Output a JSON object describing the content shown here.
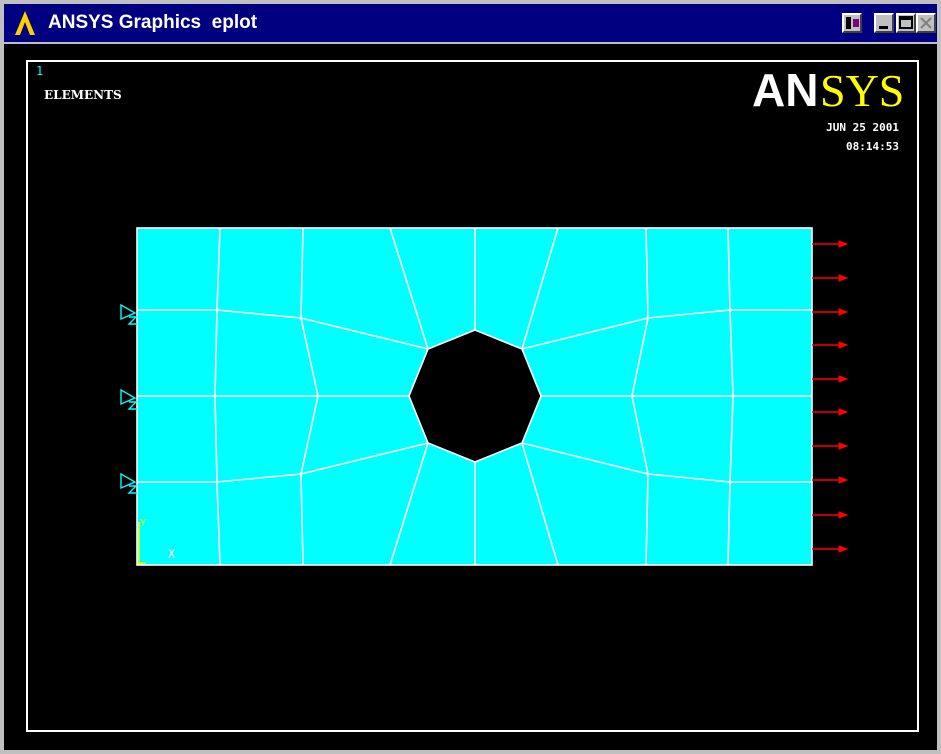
{
  "window": {
    "title": "ANSYS Graphics  eplot",
    "buttons": [
      "options",
      "minimize",
      "maximize",
      "close"
    ]
  },
  "graphics": {
    "window_number": "1",
    "plot_label": "ELEMENTS",
    "logo": {
      "an": "AN",
      "sys": "SYS"
    },
    "date": "JUN 25 2001",
    "time": "08:14:53",
    "triad": {
      "y_label": "Y",
      "x_label": "X"
    }
  },
  "colors": {
    "titlebar": "#000080",
    "background": "#000000",
    "mesh_fill": "#00ffff",
    "mesh_lines": "#ffffff",
    "load_arrows": "#ff0000",
    "constraints": "#00ffff",
    "logo_yellow": "#ffff00",
    "window_number": "#00ffff",
    "triad": "#ffff00"
  },
  "icons": [
    "ansys-logo-icon",
    "options-icon",
    "minimize-icon",
    "maximize-icon",
    "close-icon"
  ]
}
